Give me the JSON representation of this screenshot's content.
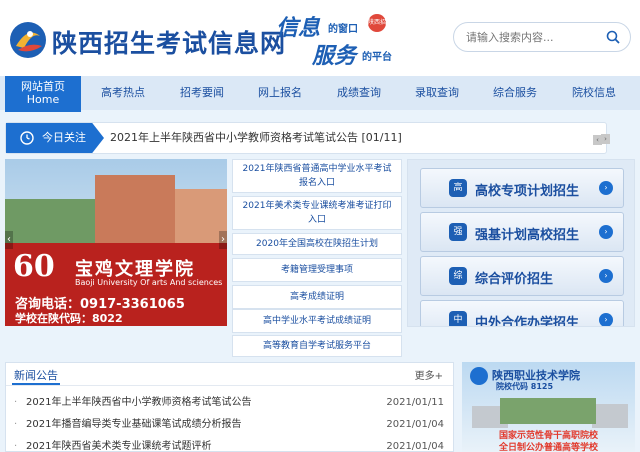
{
  "header": {
    "site_title": "陕西招生考试信息网",
    "slogan_line1_big": "信息",
    "slogan_line1_small": "的窗口",
    "slogan_line2_big": "服务",
    "slogan_line2_small": "的平台",
    "slogan_seal": "陕西招",
    "search_placeholder": "请输入搜索内容..."
  },
  "nav": {
    "home_line1": "网站首页",
    "home_line2": "Home",
    "items": [
      {
        "label": "高考热点"
      },
      {
        "label": "招考要闻"
      },
      {
        "label": "网上报名"
      },
      {
        "label": "成绩查询"
      },
      {
        "label": "录取查询"
      },
      {
        "label": "综合服务"
      },
      {
        "label": "院校信息"
      }
    ]
  },
  "ticker": {
    "label": "今日关注",
    "text": "2021年上半年陕西省中小学教师资格考试笔试公告  [01/11]",
    "prev": "‹",
    "next": "›"
  },
  "banner": {
    "big_number": "60",
    "school_cn": "宝鸡文理学院",
    "school_en": "Baoji University Of arts And sciences",
    "phone": "咨询电话：0917-3361065",
    "code": "学校在陕代码：8022",
    "prev": "‹",
    "next": "›"
  },
  "links": [
    {
      "label": "2021年陕西省普通高中学业水平考试报名入口"
    },
    {
      "label": "2021年美术类专业课统考准考证打印入口"
    },
    {
      "label": "2020年全国高校在陕招生计划"
    },
    {
      "label": "考籍管理受理事项"
    },
    {
      "label": "高考成绩证明"
    },
    {
      "label": "高中学业水平考试成绩证明"
    },
    {
      "label": "高等教育自学考试服务平台"
    }
  ],
  "special": [
    {
      "icon": "高",
      "label": "高校专项计划招生",
      "go": "›"
    },
    {
      "icon": "强",
      "label": "强基计划高校招生",
      "go": "›"
    },
    {
      "icon": "综",
      "label": "综合评价招生",
      "go": "›"
    },
    {
      "icon": "中",
      "label": "中外合作办学招生",
      "go": "›"
    }
  ],
  "news": {
    "title": "新闻公告",
    "more": "更多+",
    "items": [
      {
        "text": "2021年上半年陕西省中小学教师资格考试笔试公告",
        "date": "2021/01/11"
      },
      {
        "text": "2021年播音编导类专业基础课笔试成绩分析报告",
        "date": "2021/01/04"
      },
      {
        "text": "2021年陕西省美术类专业课统考试题评析",
        "date": "2021/01/04"
      }
    ]
  },
  "ad": {
    "name": "陕西职业技术学院",
    "code": "院校代码 8125",
    "motto1": "国家示范性骨干高职院校",
    "motto2": "全日制公办普通高等学校"
  },
  "colors": {
    "primary": "#1d6fd0",
    "brand_text": "#1b4fa0",
    "banner_red": "#b9221e",
    "accent_red": "#e23b2e"
  }
}
